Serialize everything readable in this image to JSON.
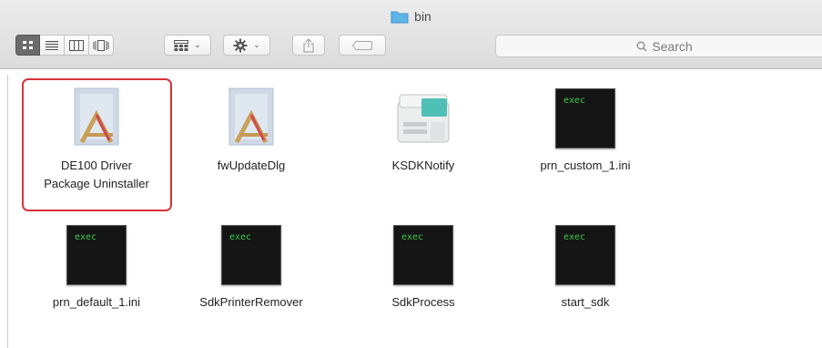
{
  "window": {
    "title": "bin",
    "folder_color": "#5fb4e8"
  },
  "toolbar": {
    "view_modes": [
      "icon-view",
      "list-view",
      "column-view",
      "cover-flow-view"
    ],
    "active_view": "icon-view",
    "search_placeholder": "Search"
  },
  "files": [
    {
      "name": "DE100 Driver Package Uninstaller",
      "line1": "DE100 Driver",
      "line2": "Package Uninstaller",
      "icon": "app-installer-icon",
      "selected": true
    },
    {
      "name": "fwUpdateDlg",
      "line1": "fwUpdateDlg",
      "icon": "app-installer-icon"
    },
    {
      "name": "KSDKNotify",
      "line1": "KSDKNotify",
      "icon": "printer-icon"
    },
    {
      "name": "prn_custom_1.ini",
      "line1": "prn_custom_1.ini",
      "icon": "exec-icon",
      "badge": "exec"
    },
    {
      "name": "prn_default_1.ini",
      "line1": "prn_default_1.ini",
      "icon": "exec-icon",
      "badge": "exec"
    },
    {
      "name": "SdkPrinterRemover",
      "line1": "SdkPrinterRemover",
      "icon": "exec-icon",
      "badge": "exec"
    },
    {
      "name": "SdkProcess",
      "line1": "SdkProcess",
      "icon": "exec-icon",
      "badge": "exec"
    },
    {
      "name": "start_sdk",
      "line1": "start_sdk",
      "icon": "exec-icon",
      "badge": "exec"
    }
  ],
  "colors": {
    "selection_border": "#d9333d",
    "exec_text": "#3ec94a"
  }
}
